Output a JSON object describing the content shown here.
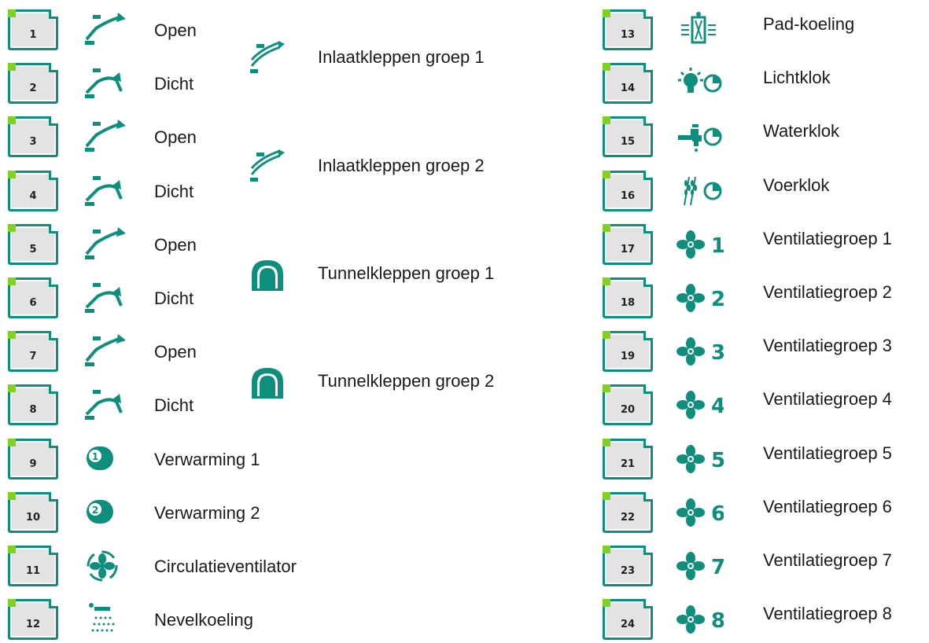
{
  "left_relays": [
    {
      "num": "1",
      "icon": "inlet-open-icon",
      "label": "Open"
    },
    {
      "num": "2",
      "icon": "inlet-closed-icon",
      "label": "Dicht"
    },
    {
      "num": "3",
      "icon": "inlet-open-icon",
      "label": "Open"
    },
    {
      "num": "4",
      "icon": "inlet-closed-icon",
      "label": "Dicht"
    },
    {
      "num": "5",
      "icon": "inlet-open-icon",
      "label": "Open"
    },
    {
      "num": "6",
      "icon": "inlet-closed-icon",
      "label": "Dicht"
    },
    {
      "num": "7",
      "icon": "inlet-open-icon",
      "label": "Open"
    },
    {
      "num": "8",
      "icon": "inlet-closed-icon",
      "label": "Dicht"
    },
    {
      "num": "9",
      "icon": "heater-1-icon",
      "label": "Verwarming 1"
    },
    {
      "num": "10",
      "icon": "heater-2-icon",
      "label": "Verwarming 2"
    },
    {
      "num": "11",
      "icon": "circulation-fan-icon",
      "label": "Circulatieventilator"
    },
    {
      "num": "12",
      "icon": "mist-cooling-icon",
      "label": "Nevelkoeling"
    }
  ],
  "groups": [
    {
      "icon": "inlet-group-icon",
      "label": "Inlaatkleppen groep 1"
    },
    {
      "icon": "inlet-group-icon",
      "label": "Inlaatkleppen groep 2"
    },
    {
      "icon": "tunnel-icon",
      "label": "Tunnelkleppen groep 1"
    },
    {
      "icon": "tunnel-icon",
      "label": "Tunnelkleppen groep 2"
    }
  ],
  "right_relays": [
    {
      "num": "13",
      "icon": "pad-cooling-icon",
      "label": "Pad-koeling"
    },
    {
      "num": "14",
      "icon": "light-clock-icon",
      "label": "Lichtklok"
    },
    {
      "num": "15",
      "icon": "water-clock-icon",
      "label": "Waterklok"
    },
    {
      "num": "16",
      "icon": "feed-clock-icon",
      "label": "Voerklok"
    },
    {
      "num": "17",
      "icon": "fan-icon",
      "digit": "1",
      "label": "Ventilatiegroep 1"
    },
    {
      "num": "18",
      "icon": "fan-icon",
      "digit": "2",
      "label": "Ventilatiegroep 2"
    },
    {
      "num": "19",
      "icon": "fan-icon",
      "digit": "3",
      "label": "Ventilatiegroep 3"
    },
    {
      "num": "20",
      "icon": "fan-icon",
      "digit": "4",
      "label": "Ventilatiegroep 4"
    },
    {
      "num": "21",
      "icon": "fan-icon",
      "digit": "5",
      "label": "Ventilatiegroep 5"
    },
    {
      "num": "22",
      "icon": "fan-icon",
      "digit": "6",
      "label": "Ventilatiegroep 6"
    },
    {
      "num": "23",
      "icon": "fan-icon",
      "digit": "7",
      "label": "Ventilatiegroep 7"
    },
    {
      "num": "24",
      "icon": "fan-icon",
      "digit": "8",
      "label": "Ventilatiegroep 8"
    }
  ],
  "colors": {
    "accent": "#0e8f7d",
    "indicator": "#7ed321",
    "relay_fill": "#e3e3e3"
  }
}
